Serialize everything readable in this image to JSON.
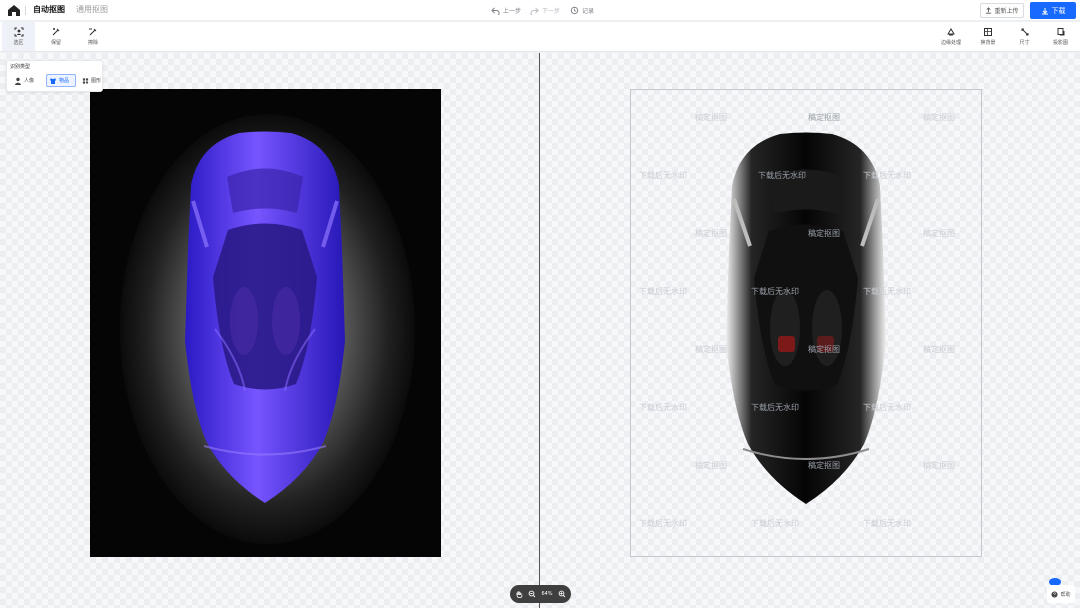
{
  "header": {
    "tabs": [
      "自动抠图",
      "通用抠图"
    ],
    "history": {
      "undo": "上一步",
      "redo": "下一步",
      "record": "记录"
    },
    "upload_label": "重新上传",
    "download_label": "下载"
  },
  "toolbar": {
    "left": [
      "选区",
      "保留",
      "擦除"
    ],
    "right": [
      "边缘处理",
      "换背景",
      "尺寸",
      "投影图"
    ]
  },
  "recognition": {
    "title": "识别类型",
    "options": [
      "人像",
      "物品",
      "图形"
    ],
    "selected": "物品"
  },
  "canvas": {
    "zoom": "64%",
    "watermarks": [
      "稿定抠图",
      "下载后无水印"
    ]
  },
  "footer": {
    "help_label": "帮助"
  },
  "colors": {
    "accent": "#1769ff",
    "selection": "#5a39e7",
    "editor_bg": "#050505"
  }
}
